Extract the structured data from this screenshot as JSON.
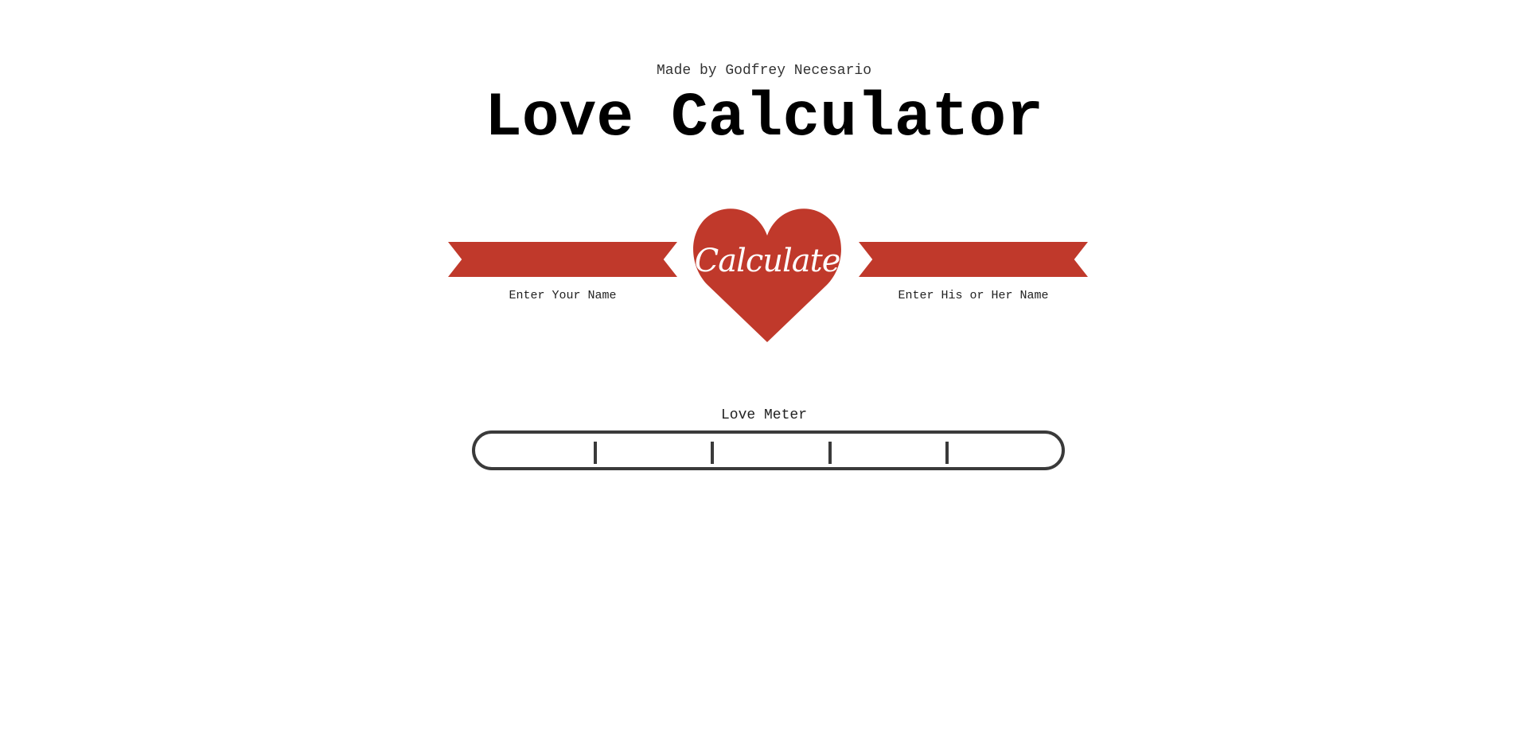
{
  "header": {
    "credit": "Made by Godfrey Necesario",
    "title": "Love Calculator"
  },
  "form": {
    "your_name_label": "Enter Your Name",
    "your_name_value": "",
    "their_name_label": "Enter His or Her Name",
    "their_name_value": "",
    "calculate_label": "Calculate"
  },
  "meter": {
    "label": "Love Meter",
    "progress_percent": 0,
    "tick_count": 4
  },
  "colors": {
    "accent": "#c0392b",
    "meter_border": "#3a3a3a",
    "background": "#ffffff"
  }
}
